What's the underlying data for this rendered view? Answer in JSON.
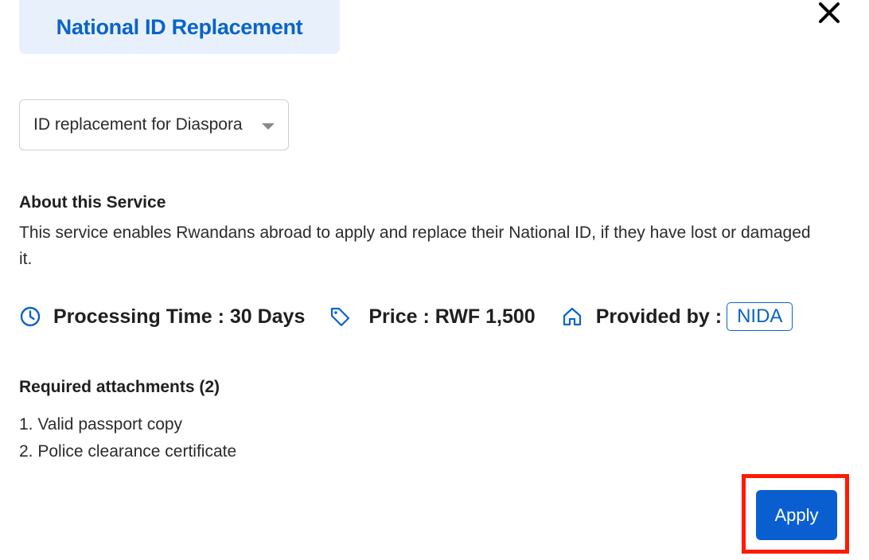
{
  "header": {
    "title": "National ID Replacement",
    "close_icon": "close-icon"
  },
  "service_select": {
    "selected": "ID replacement for Diaspora",
    "icon": "chevron-down-icon"
  },
  "about": {
    "heading": "About this Service",
    "description": "This service enables Rwandans abroad to apply and replace their National ID, if they have lost or damaged it."
  },
  "meta": {
    "processing_time": "Processing Time : 30 Days",
    "price": "Price : RWF 1,500",
    "provided_by_label": "Provided by :",
    "provider": "NIDA",
    "icons": [
      "clock-icon",
      "price-tag-icon",
      "home-icon"
    ]
  },
  "attachments": {
    "heading": "Required attachments (2)",
    "items": [
      "1. Valid passport copy",
      "2. Police clearance certificate"
    ]
  },
  "actions": {
    "apply_label": "Apply"
  },
  "colors": {
    "accent": "#0a63c9",
    "chip_bg": "#e8f1fb",
    "highlight": "#ff1a00",
    "apply_bg": "#0a5fd0"
  }
}
